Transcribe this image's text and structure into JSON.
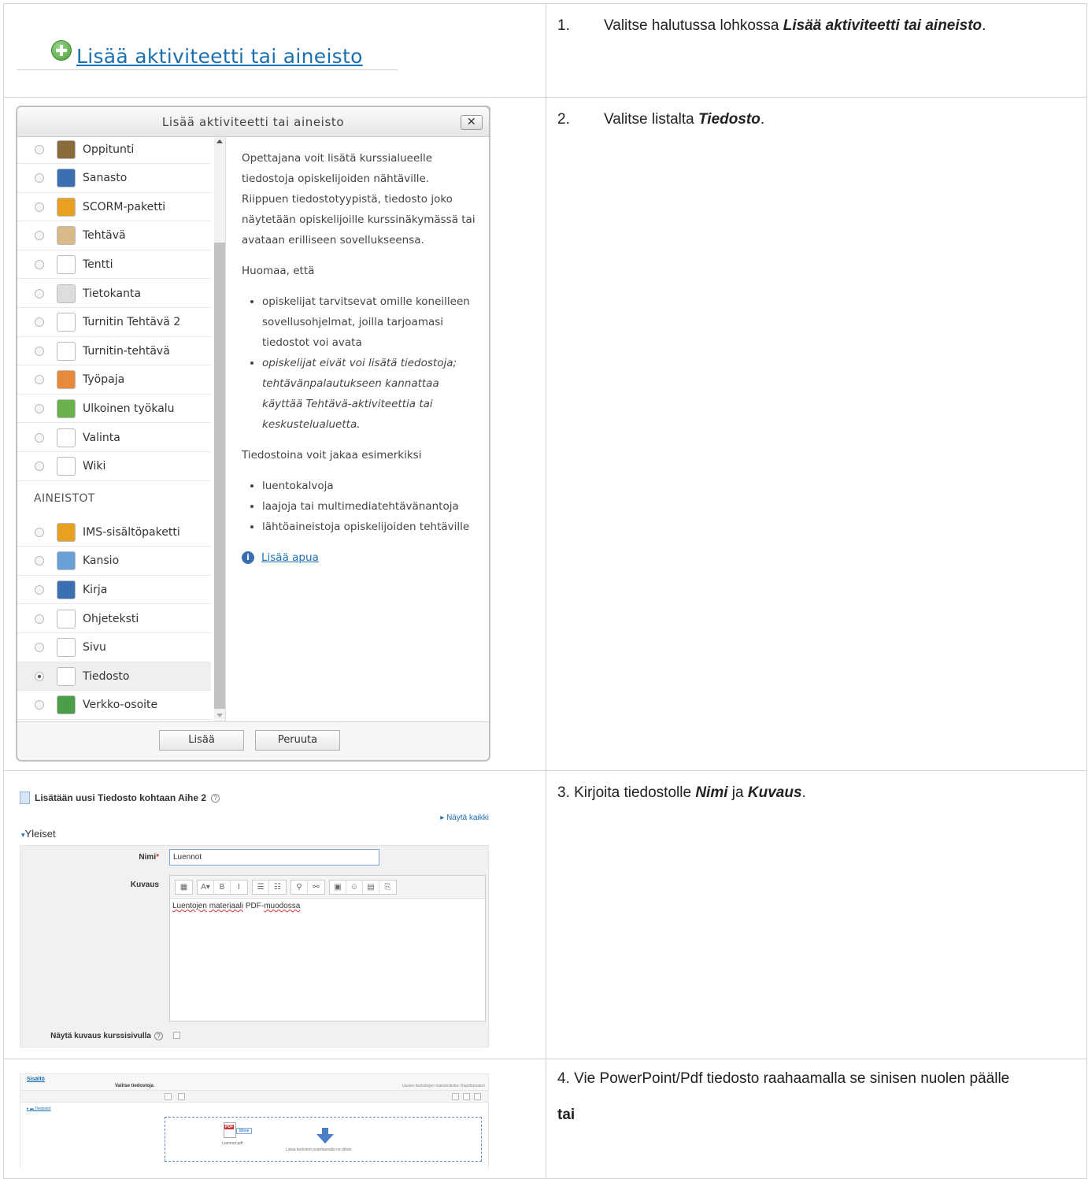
{
  "steps": [
    {
      "num": "1.",
      "pre": "Valitse halutussa lohkossa ",
      "bold": "Lisää aktiviteetti tai aineisto",
      "post": "."
    },
    {
      "num": "2.",
      "pre": "Valitse listalta ",
      "bold": "Tiedosto",
      "post": "."
    },
    {
      "text3_pre": "3. Kirjoita tiedostolle ",
      "bold1": "Nimi",
      "mid": " ja ",
      "bold2": "Kuvaus",
      "post": "."
    },
    {
      "line1": "4. Vie PowerPoint/Pdf tiedosto raahaamalla se sinisen nuolen päälle",
      "line2": "tai"
    }
  ],
  "add_link": "Lisää aktiviteetti tai aineisto",
  "modal": {
    "title": "Lisää aktiviteetti tai aineisto",
    "close": "✕",
    "activities": [
      {
        "label": "Oppitunti",
        "icon": "lesson-icon",
        "color": "#8a6a3a"
      },
      {
        "label": "Sanasto",
        "icon": "glossary-icon",
        "color": "#3b6fb1"
      },
      {
        "label": "SCORM-paketti",
        "icon": "scorm-icon",
        "color": "#e8a020"
      },
      {
        "label": "Tehtävä",
        "icon": "assignment-icon",
        "color": "#d9b98a"
      },
      {
        "label": "Tentti",
        "icon": "quiz-icon",
        "color": "#ffffff"
      },
      {
        "label": "Tietokanta",
        "icon": "database-icon",
        "color": "#dddddd"
      },
      {
        "label": "Turnitin Tehtävä 2",
        "icon": "turnitin-icon",
        "color": "#ffffff"
      },
      {
        "label": "Turnitin-tehtävä",
        "icon": "turnitin-icon",
        "color": "#ffffff"
      },
      {
        "label": "Työpaja",
        "icon": "workshop-icon",
        "color": "#e88a3a"
      },
      {
        "label": "Ulkoinen työkalu",
        "icon": "puzzle-icon",
        "color": "#6ab04c"
      },
      {
        "label": "Valinta",
        "icon": "choice-icon",
        "color": "#ffffff"
      },
      {
        "label": "Wiki",
        "icon": "wiki-icon",
        "color": "#ffffff"
      }
    ],
    "resources_heading": "AINEISTOT",
    "resources": [
      {
        "label": "IMS-sisältöpaketti",
        "icon": "ims-icon",
        "color": "#e8a020"
      },
      {
        "label": "Kansio",
        "icon": "folder-icon",
        "color": "#6aa0d8"
      },
      {
        "label": "Kirja",
        "icon": "book-icon",
        "color": "#3b6fb1"
      },
      {
        "label": "Ohjeteksti",
        "icon": "label-icon",
        "color": "#ffffff"
      },
      {
        "label": "Sivu",
        "icon": "page-icon",
        "color": "#ffffff"
      },
      {
        "label": "Tiedosto",
        "icon": "file-icon",
        "color": "#ffffff"
      },
      {
        "label": "Verkko-osoite",
        "icon": "url-icon",
        "color": "#4a9e4a"
      }
    ],
    "selected": "Tiedosto",
    "desc_p1": "Opettajana voit lisätä kurssialueelle tiedostoja opiskelijoiden nähtäville. Riippuen tiedostotyypistä, tiedosto joko näytetään opiskelijoille kurssinäkymässä tai avataan erilliseen sovellukseensa.",
    "desc_p2": "Huomaa, että",
    "note1": "opiskelijat tarvitsevat omille koneilleen sovellusohjelmat, joilla tarjoamasi tiedostot voi avata",
    "note2": "opiskelijat eivät voi lisätä tiedostoja; tehtävänpalautukseen kannattaa käyttää Tehtävä-aktiviteettia tai keskustelualuetta.",
    "desc_p3": "Tiedostoina voit jakaa esimerkiksi",
    "ex1": "luentokalvoja",
    "ex2": "laajoja tai multimediatehtävänantoja",
    "ex3": "lähtöaineistoja opiskelijoiden tehtäville",
    "help": "Lisää apua",
    "add_btn": "Lisää",
    "cancel_btn": "Peruuta"
  },
  "form": {
    "title": "Lisätään uusi Tiedosto kohtaan Aihe 2",
    "show_all": "▸ Näytä kaikki",
    "section": "Yleiset",
    "name_label": "Nimi",
    "name_req": "*",
    "name_value": "Luennot",
    "desc_label": "Kuvaus",
    "desc_word1": "Luentojen",
    "desc_word2": "materiaali",
    "desc_word3": "PDF-",
    "desc_word4": "muodossa",
    "show_desc_label": "Näytä kuvaus kurssisivulla",
    "toolbar": [
      "▦",
      "A▾",
      "B",
      "I",
      "☰",
      "☷",
      "⚲",
      "⚯",
      "▣",
      "☺",
      "▤",
      "⎘"
    ]
  },
  "picker": {
    "section": "Sisältö",
    "label": "Valitse tiedostoja",
    "max": "Uusien tiedostojen maksimikoko: Rajoittamaton",
    "folder": "▸ ▬ Tiedostot",
    "move": "Move",
    "fname": "Luennot.pdf",
    "hint": "Lataa tiedostot pudottamalla ne tähän"
  }
}
